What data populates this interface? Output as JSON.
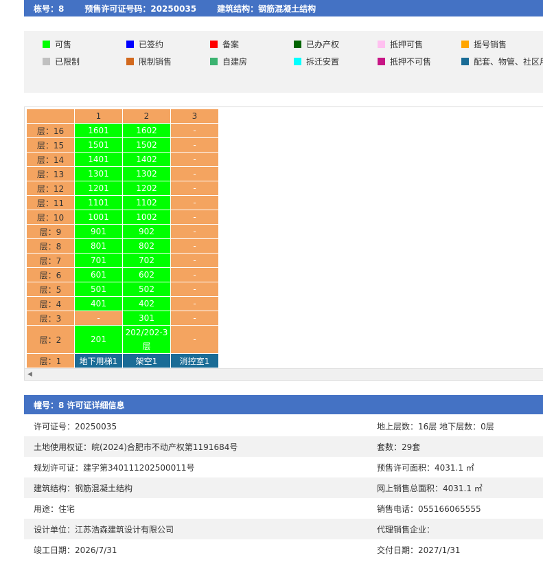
{
  "header": {
    "building_label": "栋号：8",
    "permit_label": "预售许可证号码：20250035",
    "structure_label": "建筑结构：钢筋混凝土结构"
  },
  "legend": [
    {
      "label": "可售",
      "color": "#00ff00",
      "icon": "square"
    },
    {
      "label": "已签约",
      "color": "#0000ff",
      "icon": "square"
    },
    {
      "label": "备案",
      "color": "#ff0000",
      "icon": "square"
    },
    {
      "label": "已办产权",
      "color": "#006400",
      "icon": "square"
    },
    {
      "label": "抵押可售",
      "color": "#ffc0f0",
      "icon": "square"
    },
    {
      "label": "摇号销售",
      "color": "#ffa500",
      "icon": "square"
    },
    {
      "label": "已限制",
      "color": "#c0c0c0",
      "icon": "square"
    },
    {
      "label": "限制销售",
      "color": "#d2691e",
      "icon": "square"
    },
    {
      "label": "自建房",
      "color": "#3cb371",
      "icon": "square"
    },
    {
      "label": "拆迁安置",
      "color": "#00ffff",
      "icon": "square"
    },
    {
      "label": "抵押不可售",
      "color": "#c71585",
      "icon": "square"
    },
    {
      "label": "配套、物管、社区用",
      "color": "#1a6c96",
      "icon": "square"
    }
  ],
  "grid": {
    "columns": [
      "1",
      "2",
      "3"
    ],
    "rows": [
      {
        "floor": "层：16",
        "cells": [
          {
            "t": "1601",
            "s": "sale"
          },
          {
            "t": "1602",
            "s": "sale"
          },
          {
            "t": "-",
            "s": "empty"
          }
        ]
      },
      {
        "floor": "层：15",
        "cells": [
          {
            "t": "1501",
            "s": "sale"
          },
          {
            "t": "1502",
            "s": "sale"
          },
          {
            "t": "-",
            "s": "empty"
          }
        ]
      },
      {
        "floor": "层：14",
        "cells": [
          {
            "t": "1401",
            "s": "sale"
          },
          {
            "t": "1402",
            "s": "sale"
          },
          {
            "t": "-",
            "s": "empty"
          }
        ]
      },
      {
        "floor": "层：13",
        "cells": [
          {
            "t": "1301",
            "s": "sale"
          },
          {
            "t": "1302",
            "s": "sale"
          },
          {
            "t": "-",
            "s": "empty"
          }
        ]
      },
      {
        "floor": "层：12",
        "cells": [
          {
            "t": "1201",
            "s": "sale"
          },
          {
            "t": "1202",
            "s": "sale"
          },
          {
            "t": "-",
            "s": "empty"
          }
        ]
      },
      {
        "floor": "层：11",
        "cells": [
          {
            "t": "1101",
            "s": "sale"
          },
          {
            "t": "1102",
            "s": "sale"
          },
          {
            "t": "-",
            "s": "empty"
          }
        ]
      },
      {
        "floor": "层：10",
        "cells": [
          {
            "t": "1001",
            "s": "sale"
          },
          {
            "t": "1002",
            "s": "sale"
          },
          {
            "t": "-",
            "s": "empty"
          }
        ]
      },
      {
        "floor": "层：9",
        "cells": [
          {
            "t": "901",
            "s": "sale"
          },
          {
            "t": "902",
            "s": "sale"
          },
          {
            "t": "-",
            "s": "empty"
          }
        ]
      },
      {
        "floor": "层：8",
        "cells": [
          {
            "t": "801",
            "s": "sale"
          },
          {
            "t": "802",
            "s": "sale"
          },
          {
            "t": "-",
            "s": "empty"
          }
        ]
      },
      {
        "floor": "层：7",
        "cells": [
          {
            "t": "701",
            "s": "sale"
          },
          {
            "t": "702",
            "s": "sale"
          },
          {
            "t": "-",
            "s": "empty"
          }
        ]
      },
      {
        "floor": "层：6",
        "cells": [
          {
            "t": "601",
            "s": "sale"
          },
          {
            "t": "602",
            "s": "sale"
          },
          {
            "t": "-",
            "s": "empty"
          }
        ]
      },
      {
        "floor": "层：5",
        "cells": [
          {
            "t": "501",
            "s": "sale"
          },
          {
            "t": "502",
            "s": "sale"
          },
          {
            "t": "-",
            "s": "empty"
          }
        ]
      },
      {
        "floor": "层：4",
        "cells": [
          {
            "t": "401",
            "s": "sale"
          },
          {
            "t": "402",
            "s": "sale"
          },
          {
            "t": "-",
            "s": "empty"
          }
        ]
      },
      {
        "floor": "层：3",
        "cells": [
          {
            "t": "-",
            "s": "empty"
          },
          {
            "t": "301",
            "s": "sale"
          },
          {
            "t": "-",
            "s": "empty"
          }
        ]
      },
      {
        "floor": "层：2",
        "tall": true,
        "cells": [
          {
            "t": "201",
            "s": "sale"
          },
          {
            "t": "202/202-3层",
            "s": "sale"
          },
          {
            "t": "-",
            "s": "empty"
          }
        ]
      },
      {
        "floor": "层：1",
        "cells": [
          {
            "t": "地下用梯1",
            "s": "other"
          },
          {
            "t": "架空1",
            "s": "other"
          },
          {
            "t": "消控室1",
            "s": "other"
          }
        ]
      }
    ]
  },
  "details": {
    "title": "幢号：8 许可证详细信息",
    "rows": [
      {
        "left": "许可证号：20250035",
        "right": "地上层数：16层  地下层数：0层"
      },
      {
        "left": "土地使用权证：皖(2024)合肥市不动产权第1191684号",
        "right": "套数：29套"
      },
      {
        "left": "规划许可证：建字第340111202500011号",
        "right": "预售许可面积：4031.1 ㎡"
      },
      {
        "left": "建筑结构：钢筋混凝土结构",
        "right": "网上销售总面积：4031.1 ㎡"
      },
      {
        "left": "用途：住宅",
        "right": "销售电话：055166065555"
      },
      {
        "left": "设计单位：江苏浩森建筑设计有限公司",
        "right": "代理销售企业："
      },
      {
        "left": "竣工日期：2026/7/31",
        "right": "交付日期：2027/1/31"
      }
    ]
  }
}
